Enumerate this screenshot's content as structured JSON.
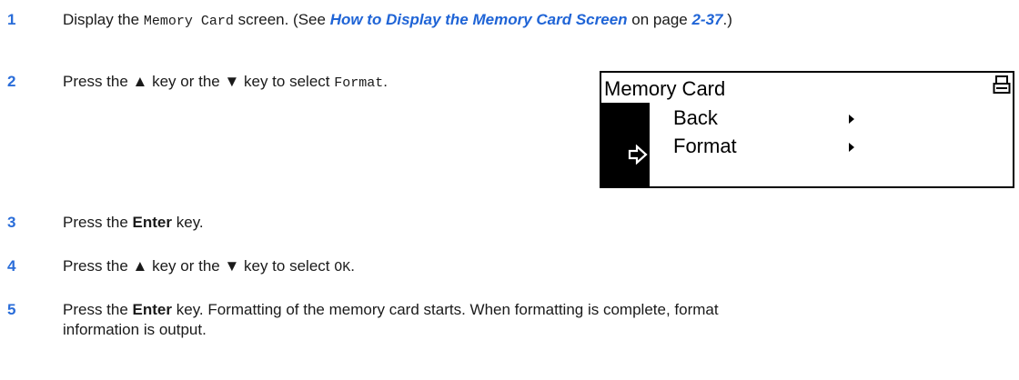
{
  "steps": [
    {
      "num": "1",
      "parts": [
        {
          "t": "text",
          "v": "Display the "
        },
        {
          "t": "mono",
          "v": "Memory Card"
        },
        {
          "t": "text",
          "v": " screen. (See "
        },
        {
          "t": "link",
          "v": "How to Display the Memory Card Screen"
        },
        {
          "t": "text",
          "v": " on page "
        },
        {
          "t": "link",
          "v": "2-37"
        },
        {
          "t": "text",
          "v": ".)"
        }
      ]
    },
    {
      "num": "2",
      "parts": [
        {
          "t": "text",
          "v": "Press the ▲ key or the ▼ key to select "
        },
        {
          "t": "mono",
          "v": "Format"
        },
        {
          "t": "text",
          "v": "."
        }
      ]
    },
    {
      "num": "3",
      "parts": [
        {
          "t": "text",
          "v": "Press the "
        },
        {
          "t": "bold",
          "v": "Enter"
        },
        {
          "t": "text",
          "v": " key."
        }
      ]
    },
    {
      "num": "4",
      "parts": [
        {
          "t": "text",
          "v": "Press the ▲ key or the ▼ key to select "
        },
        {
          "t": "mono",
          "v": "OK"
        },
        {
          "t": "text",
          "v": "."
        }
      ]
    },
    {
      "num": "5",
      "parts": [
        {
          "t": "text",
          "v": "Press the "
        },
        {
          "t": "bold",
          "v": "Enter"
        },
        {
          "t": "text",
          "v": " key. Formatting of the memory card starts. When formatting is complete, format\ninformation is output."
        }
      ]
    }
  ],
  "lcd": {
    "title": "Memory Card",
    "icon": "printer-icon",
    "items": [
      {
        "label": "Back",
        "selected": false
      },
      {
        "label": "Format",
        "selected": true
      }
    ]
  }
}
